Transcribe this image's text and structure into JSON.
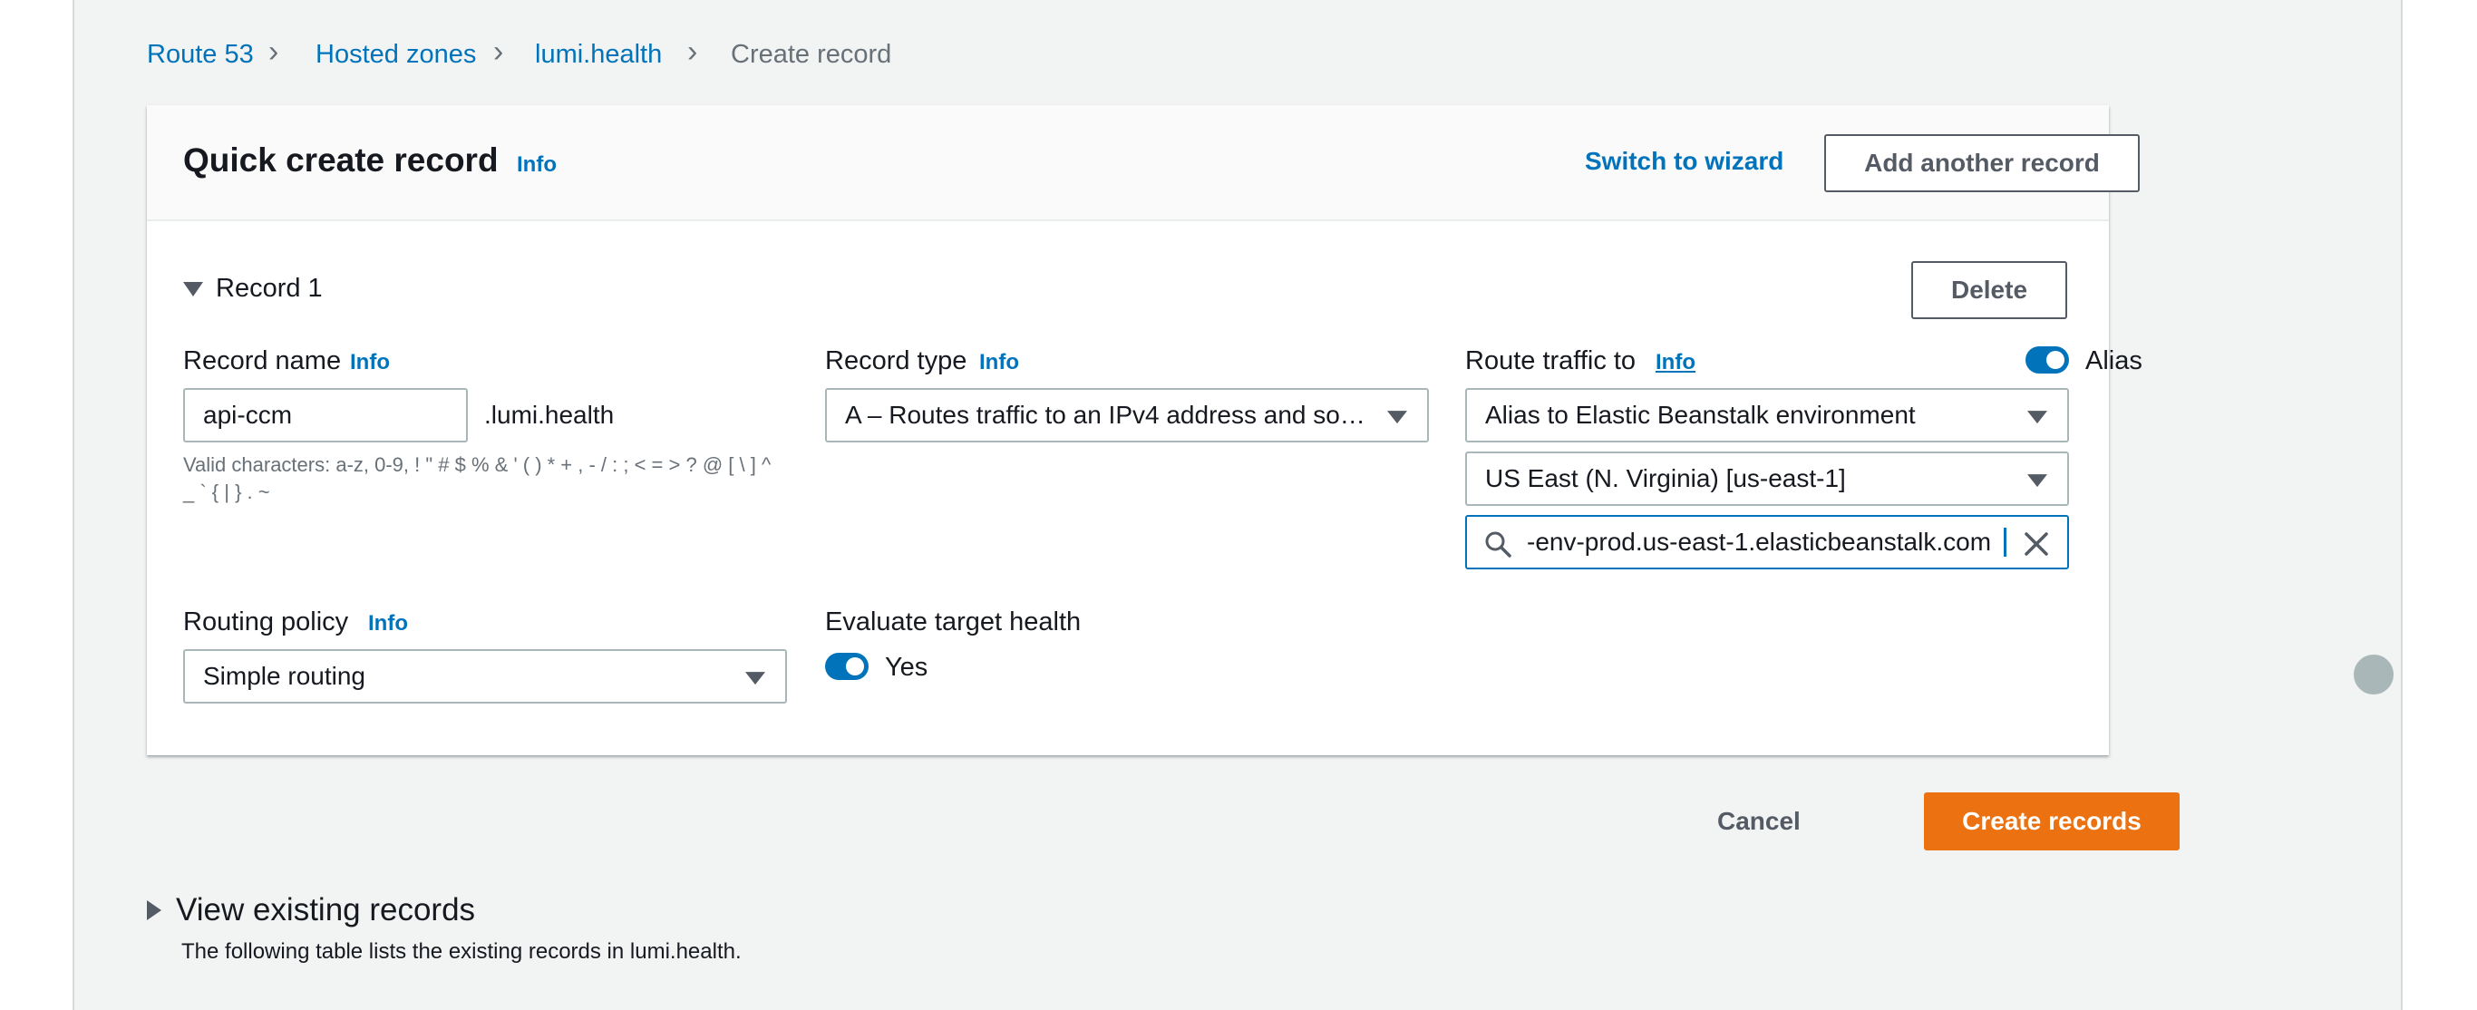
{
  "breadcrumb": {
    "items": [
      "Route 53",
      "Hosted zones",
      "lumi.health"
    ],
    "current": "Create record"
  },
  "header": {
    "title": "Quick create record",
    "info": "Info",
    "switch_label": "Switch to wizard",
    "add_label": "Add another record"
  },
  "record": {
    "title": "Record 1",
    "delete_label": "Delete",
    "name": {
      "label": "Record name",
      "info": "Info",
      "value": "api-ccm",
      "suffix": ".lumi.health",
      "hint": "Valid characters: a-z, 0-9, ! \" # $ % & ' ( ) * + , - / : ; < = > ? @ [ \\ ] ^ _ ` { | } . ~"
    },
    "type": {
      "label": "Record type",
      "info": "Info",
      "value": "A – Routes traffic to an IPv4 address and so…"
    },
    "route": {
      "label": "Route traffic to",
      "info": "Info",
      "alias_label": "Alias",
      "alias_on": true,
      "endpoint": "Alias to Elastic Beanstalk environment",
      "region": "US East (N. Virginia) [us-east-1]",
      "search_value": "-env-prod.us-east-1.elasticbeanstalk.com"
    },
    "policy": {
      "label": "Routing policy",
      "info": "Info",
      "value": "Simple routing"
    },
    "health": {
      "label": "Evaluate target health",
      "value_label": "Yes",
      "on": true
    }
  },
  "actions": {
    "cancel": "Cancel",
    "create": "Create records"
  },
  "existing": {
    "title": "View existing records",
    "desc": "The following table lists the existing records in lumi.health."
  },
  "colors": {
    "accent": "#0073bb",
    "primary": "#ec7211",
    "background": "#f2f3f3"
  }
}
